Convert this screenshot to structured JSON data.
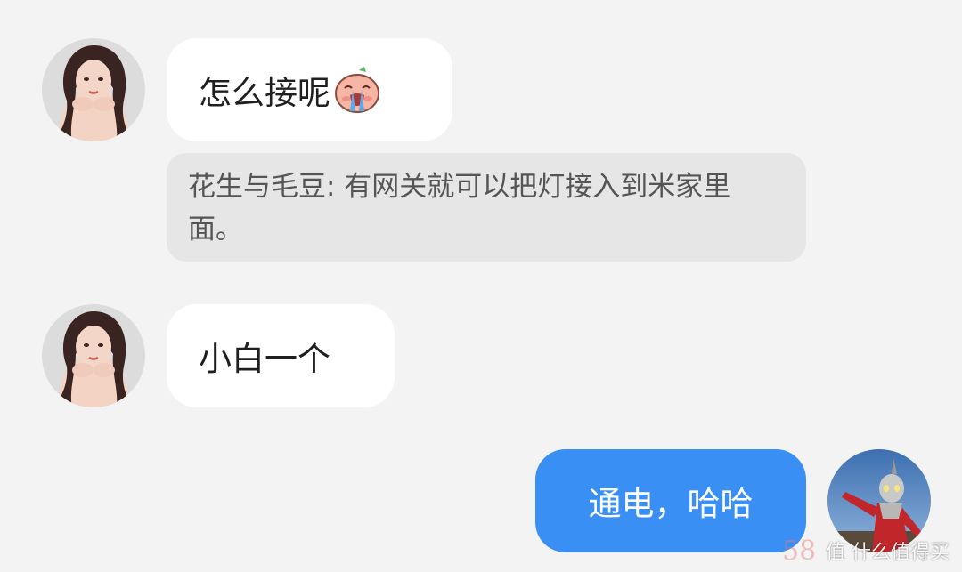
{
  "messages": [
    {
      "id": "m1",
      "side": "incoming",
      "text": "怎么接呢",
      "emoji": "crying-face-emoji",
      "avatar": "female-user-avatar"
    },
    {
      "id": "q1",
      "side": "quote",
      "text": "花生与毛豆: 有网关就可以把灯接入到米家里面。"
    },
    {
      "id": "m2",
      "side": "incoming",
      "text": "小白一个",
      "avatar": "female-user-avatar"
    },
    {
      "id": "m3",
      "side": "outgoing",
      "text": "通电，哈哈",
      "avatar": "ultraman-avatar"
    }
  ],
  "watermark": {
    "text": "值 什么值得买",
    "number": "58"
  },
  "colors": {
    "background": "#f3f3f3",
    "incoming_bubble": "#ffffff",
    "outgoing_bubble": "#3a8ff5",
    "quote_bubble": "#e6e6e6"
  }
}
